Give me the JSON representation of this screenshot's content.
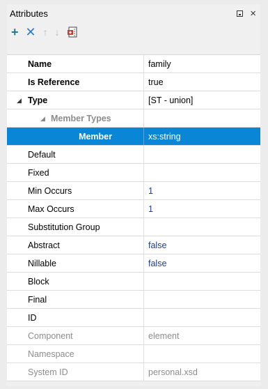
{
  "panel": {
    "title": "Attributes"
  },
  "toolbar": {
    "add_icon": "+",
    "delete_icon": "✕",
    "up_icon": "🡅",
    "down_icon": "🡇",
    "extract_icon": "doc-icon"
  },
  "rows": [
    {
      "name": "Name",
      "value": "family"
    },
    {
      "name": "Is Reference",
      "value": "true"
    },
    {
      "name": "Type",
      "value": "[ST - union]"
    },
    {
      "name": "Member Types",
      "value": ""
    },
    {
      "name": "Member",
      "value": "xs:string"
    },
    {
      "name": "Default",
      "value": ""
    },
    {
      "name": "Fixed",
      "value": ""
    },
    {
      "name": "Min Occurs",
      "value": "1"
    },
    {
      "name": "Max Occurs",
      "value": "1"
    },
    {
      "name": "Substitution Group",
      "value": ""
    },
    {
      "name": "Abstract",
      "value": "false"
    },
    {
      "name": "Nillable",
      "value": "false"
    },
    {
      "name": "Block",
      "value": ""
    },
    {
      "name": "Final",
      "value": ""
    },
    {
      "name": "ID",
      "value": ""
    },
    {
      "name": "Component",
      "value": "element"
    },
    {
      "name": "Namespace",
      "value": ""
    },
    {
      "name": "System ID",
      "value": "personal.xsd"
    }
  ],
  "colors": {
    "selection": "#0a86d6",
    "value_blue": "#1a3c9a",
    "disabled": "#8c8c8c"
  }
}
